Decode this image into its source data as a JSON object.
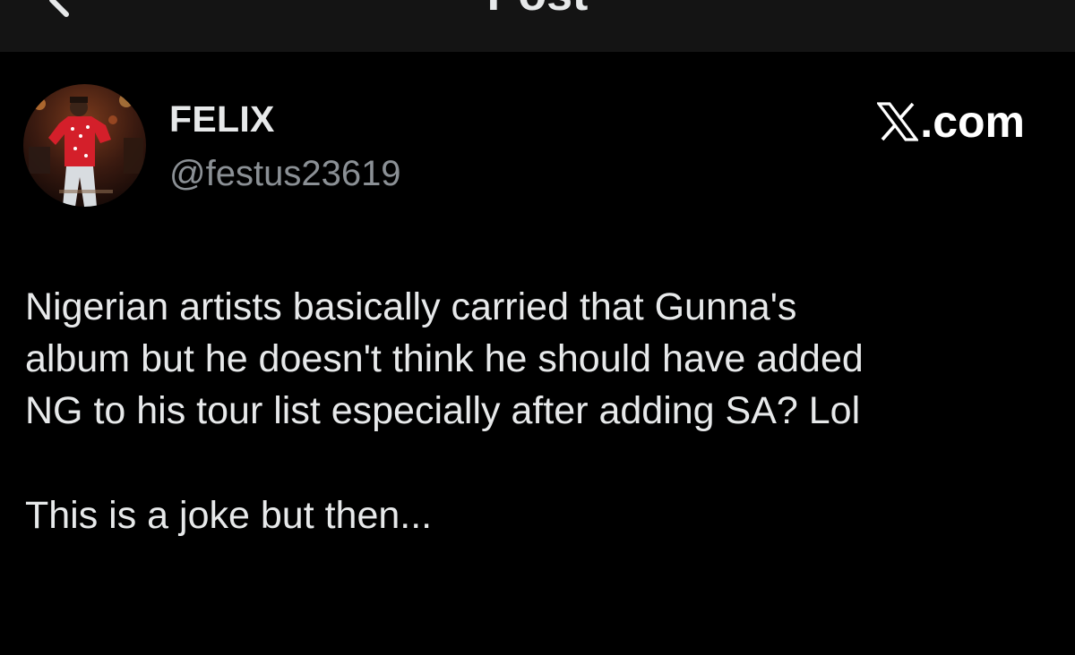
{
  "header": {
    "title": "Post",
    "back_icon": "chevron-left-icon"
  },
  "author": {
    "name": "FELIX",
    "handle": "@festus23619",
    "avatar_icon": "profile-photo"
  },
  "source": {
    "logo_icon": "x-logo-icon",
    "label": ".com"
  },
  "tweet": {
    "lines": [
      "Nigerian artists basically carried that Gunna's",
      "album but he doesn't think he should have added",
      "NG to his tour list especially after adding SA? Lol"
    ],
    "closing_line": "This is a joke but then..."
  },
  "colors": {
    "background": "#000000",
    "header_bar": "#141414",
    "primary_text": "#e7e9ea",
    "secondary_text": "#8b9095"
  }
}
